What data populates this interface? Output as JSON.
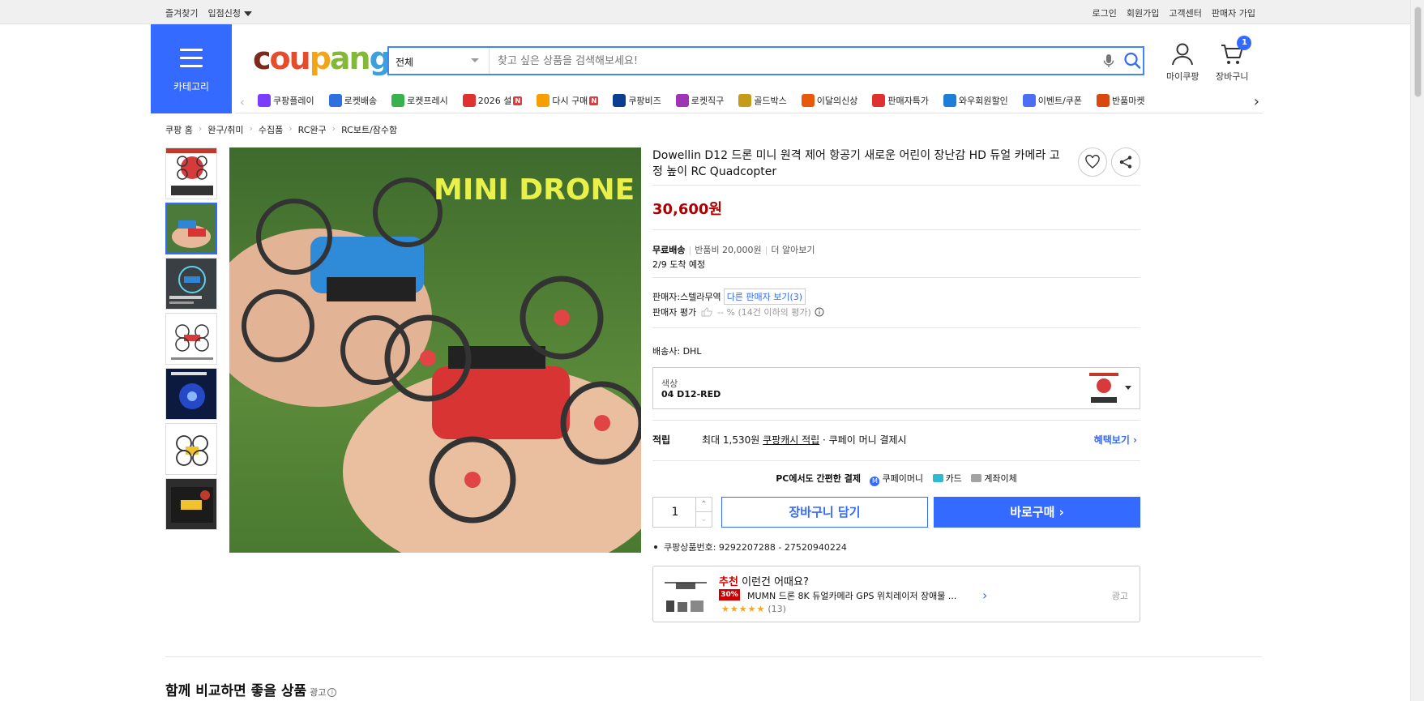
{
  "topbar": {
    "left": [
      "즐겨찾기",
      "입점신청"
    ],
    "right": [
      "로그인",
      "회원가입",
      "고객센터",
      "판매자 가입"
    ]
  },
  "header": {
    "category_label": "카테고리",
    "logo": {
      "c1": "c",
      "c2": "ou",
      "c3": "p",
      "c4": "an",
      "c5": "g"
    },
    "search": {
      "category": "전체",
      "placeholder": "찾고 싶은 상품을 검색해보세요!"
    },
    "mycoupang": "마이쿠팡",
    "cart": "장바구니",
    "cart_count": "1"
  },
  "subnav": [
    {
      "label": "쿠팡플레이",
      "color": "#7b3dff",
      "badge": ""
    },
    {
      "label": "로켓배송",
      "color": "#2f6fe0",
      "badge": ""
    },
    {
      "label": "로켓프레시",
      "color": "#37b24d",
      "badge": ""
    },
    {
      "label": "2026 설",
      "color": "#e03131",
      "badge": "N"
    },
    {
      "label": "다시 구매",
      "color": "#f59f00",
      "badge": "N"
    },
    {
      "label": "쿠팡비즈",
      "color": "#0b3d91",
      "badge": ""
    },
    {
      "label": "로켓직구",
      "color": "#9c36b5",
      "badge": ""
    },
    {
      "label": "골드박스",
      "color": "#c69b1a",
      "badge": ""
    },
    {
      "label": "이달의신상",
      "color": "#e8590c",
      "badge": ""
    },
    {
      "label": "판매자특가",
      "color": "#e03131",
      "badge": ""
    },
    {
      "label": "와우회원할인",
      "color": "#1c7ed6",
      "badge": ""
    },
    {
      "label": "이벤트/쿠폰",
      "color": "#4c6ef5",
      "badge": ""
    },
    {
      "label": "반품마켓",
      "color": "#d9480f",
      "badge": ""
    }
  ],
  "breadcrumb": [
    "쿠팡 홈",
    "완구/취미",
    "수집품",
    "RC완구",
    "RC보트/잠수함"
  ],
  "gallery": {
    "main_text": "MINI DRONE"
  },
  "product": {
    "title": "Dowellin D12 드론 미니 원격 제어 항공기 새로운 어린이 장난감 HD 듀얼 카메라 고정 높이 RC Quadcopter",
    "price": "30,600원",
    "free_shipping": "무료배송",
    "return_fee": "반품비 20,000원",
    "learn_more": "더 알아보기",
    "arrival": "2/9 도착 예정",
    "seller_label": "판매자:",
    "seller_name": "스텔라무역",
    "other_sellers": "다른 판매자 보기(3)",
    "rating_label": "판매자 평가",
    "rating_value": "-- % (14건 이하의 평가)",
    "courier_label": "배송사:",
    "courier": "DHL",
    "option_label": "색상",
    "option_value": "04 D12-RED",
    "reward_label": "적립",
    "reward_max": "최대 1,530원",
    "reward_link": "쿠팡캐시 적립",
    "reward_note": "· 쿠페이 머니 결제시",
    "reward_more": "혜택보기 ›",
    "easypay_label": "PC에서도 간편한 결제",
    "easypay_items": [
      "쿠페이머니",
      "카드",
      "계좌이체"
    ],
    "quantity": "1",
    "add_cart": "장바구니 담기",
    "buy_now": "바로구매 ›",
    "product_no": "쿠팡상품번호: 9292207288 - 27520940224"
  },
  "recommend": {
    "title_red": "추천",
    "title": "이런건 어때요?",
    "discount": "30%",
    "name": "MUMN 드론 8K 듀얼카메라 GPS 위치레이저 장애물 ...",
    "stars": "★★★★★",
    "reviews": "(13)",
    "ad": "광고"
  },
  "compare": {
    "title": "함께 비교하면 좋을 상품",
    "ad": "광고",
    "info": "i"
  }
}
